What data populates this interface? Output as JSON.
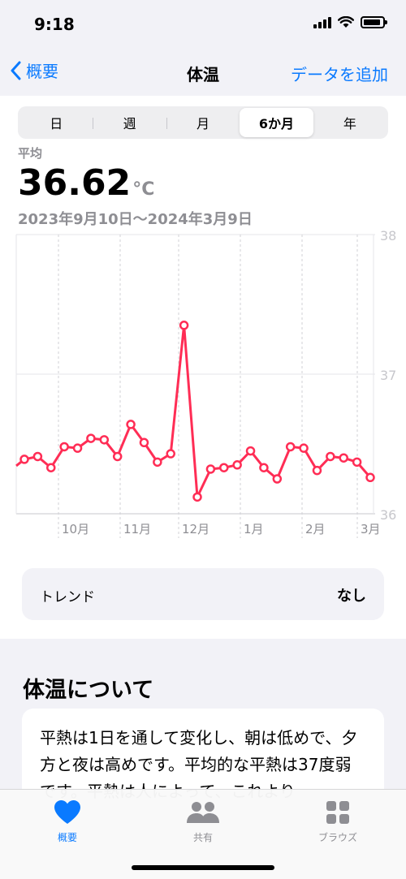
{
  "status": {
    "time": "9:18"
  },
  "nav": {
    "back_label": "概要",
    "title": "体温",
    "action": "データを追加"
  },
  "segments": [
    "日",
    "週",
    "月",
    "6か月",
    "年"
  ],
  "summary": {
    "label": "平均",
    "value": "36.62",
    "unit": "°C",
    "date_range": "2023年9月10日〜2024年3月9日"
  },
  "chart_data": {
    "type": "line",
    "ylim": [
      36,
      38
    ],
    "y_ticks": [
      "38",
      "37",
      "36"
    ],
    "x_labels": [
      "10月",
      "11月",
      "12月",
      "1月",
      "2月",
      "3月"
    ],
    "grid": true,
    "series": [
      {
        "color": "#ff2d55",
        "values": [
          36.39,
          36.41,
          36.33,
          36.48,
          36.47,
          36.54,
          36.53,
          36.41,
          36.64,
          36.51,
          36.37,
          36.43,
          37.35,
          36.12,
          36.32,
          36.33,
          36.35,
          36.45,
          36.33,
          36.25,
          36.48,
          36.47,
          36.31,
          36.41,
          36.4,
          36.37,
          36.26
        ]
      }
    ]
  },
  "trend": {
    "label": "トレンド",
    "value": "なし"
  },
  "about": {
    "title": "体温について",
    "text": "平熱は1日を通して変化し、朝は低めで、夕方と夜は高めです。平均的な平熱は37度弱です。平熱は人によって、これより"
  },
  "tabs": [
    {
      "label": "概要",
      "icon": "heart-icon"
    },
    {
      "label": "共有",
      "icon": "people-icon"
    },
    {
      "label": "ブラウズ",
      "icon": "grid-icon"
    }
  ],
  "colors": {
    "accent": "#0a7aff",
    "series": "#ff2d55",
    "secondary": "#8e8e93"
  }
}
